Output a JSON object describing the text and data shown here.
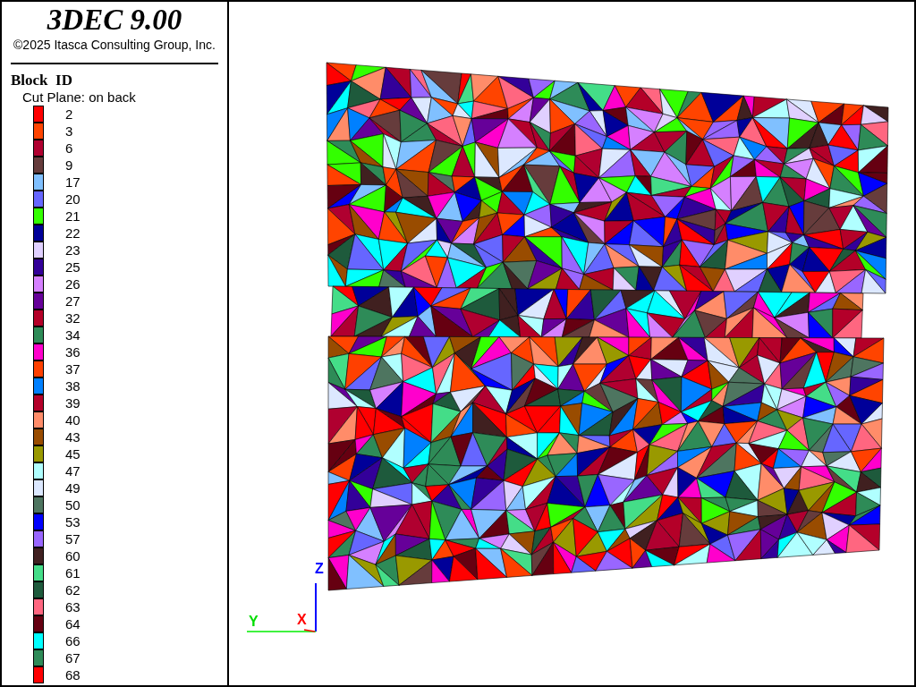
{
  "title": "3DEC 9.00",
  "copyright": "©2025 Itasca Consulting Group, Inc.",
  "legend": {
    "title": "Block  ID",
    "subtitle": "Cut Plane: on back",
    "items": [
      {
        "label": "2",
        "color": "#ff0000"
      },
      {
        "label": "3",
        "color": "#ff4400"
      },
      {
        "label": "6",
        "color": "#b00030"
      },
      {
        "label": "9",
        "color": "#663c3c"
      },
      {
        "label": "17",
        "color": "#80c0ff"
      },
      {
        "label": "20",
        "color": "#6666ff"
      },
      {
        "label": "21",
        "color": "#33ff00"
      },
      {
        "label": "22",
        "color": "#000099"
      },
      {
        "label": "23",
        "color": "#e0d0ff"
      },
      {
        "label": "25",
        "color": "#330099"
      },
      {
        "label": "26",
        "color": "#d580ff"
      },
      {
        "label": "27",
        "color": "#660099"
      },
      {
        "label": "32",
        "color": "#b40028"
      },
      {
        "label": "34",
        "color": "#2e8b57"
      },
      {
        "label": "36",
        "color": "#ff00cc"
      },
      {
        "label": "37",
        "color": "#ff4000"
      },
      {
        "label": "38",
        "color": "#0080ff"
      },
      {
        "label": "39",
        "color": "#b4002a"
      },
      {
        "label": "40",
        "color": "#ff8c69"
      },
      {
        "label": "43",
        "color": "#994c00"
      },
      {
        "label": "45",
        "color": "#999900"
      },
      {
        "label": "47",
        "color": "#b0ffff"
      },
      {
        "label": "49",
        "color": "#dce8ff"
      },
      {
        "label": "50",
        "color": "#4e7560"
      },
      {
        "label": "53",
        "color": "#0000ff"
      },
      {
        "label": "57",
        "color": "#9966ff"
      },
      {
        "label": "60",
        "color": "#402020"
      },
      {
        "label": "61",
        "color": "#44dd88"
      },
      {
        "label": "62",
        "color": "#1e5a3c"
      },
      {
        "label": "63",
        "color": "#ff6680"
      },
      {
        "label": "64",
        "color": "#660011"
      },
      {
        "label": "66",
        "color": "#00ffff"
      },
      {
        "label": "67",
        "color": "#2e8b58"
      },
      {
        "label": "68",
        "color": "#ff0001"
      }
    ]
  },
  "axes": {
    "z": "Z",
    "y": "Y",
    "x": "X"
  }
}
